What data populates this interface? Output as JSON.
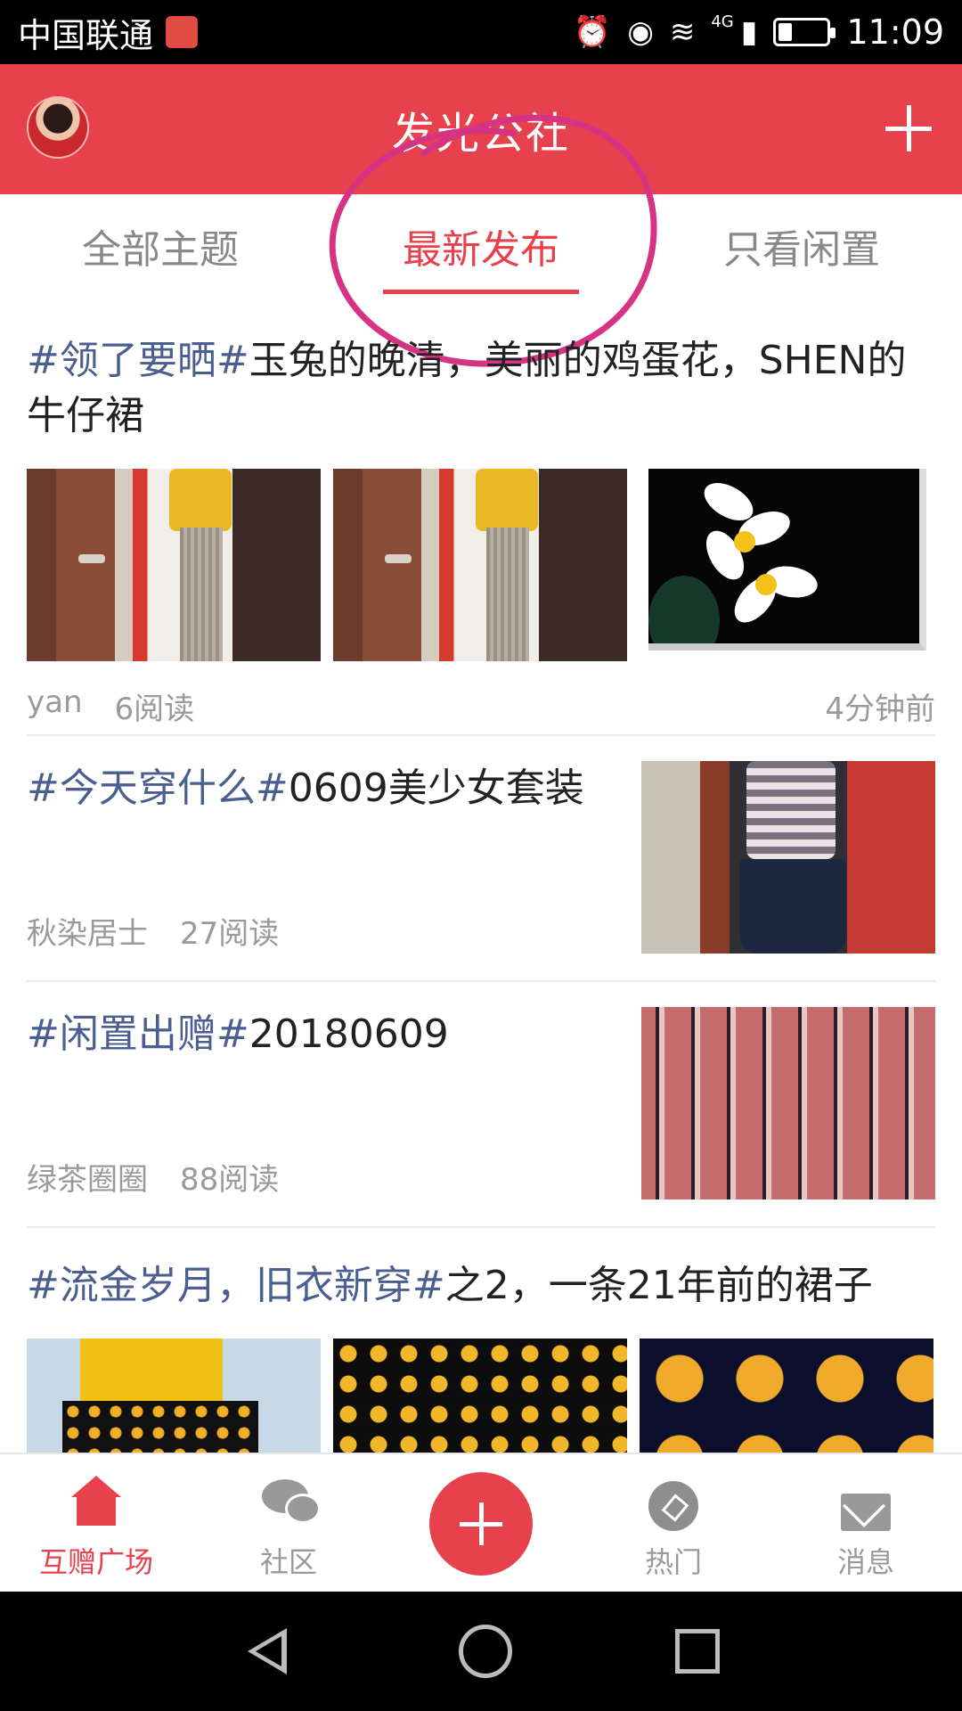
{
  "status_bar": {
    "carrier": "中国联通",
    "network": "4G",
    "time": "11:09",
    "battery_level": 0.25
  },
  "header": {
    "title": "发光公社"
  },
  "tabs": [
    {
      "label": "全部主题",
      "active": false
    },
    {
      "label": "最新发布",
      "active": true
    },
    {
      "label": "只看闲置",
      "active": false
    }
  ],
  "posts": [
    {
      "topic": "#领了要晒#",
      "title": "玉兔的晚清，美丽的鸡蛋花，SHEN的牛仔裙",
      "author": "yan",
      "views": "6阅读",
      "time": "4分钟前"
    },
    {
      "topic": "#今天穿什么#",
      "title": "0609美少女套装",
      "author": "秋染居士",
      "views": "27阅读"
    },
    {
      "topic": "#闲置出赠#",
      "title": "20180609",
      "author": "绿茶圈圈",
      "views": "88阅读"
    },
    {
      "topic": "#流金岁月，旧衣新穿#",
      "title": "之2，一条21年前的裙子"
    }
  ],
  "bottom_nav": [
    {
      "label": "互赠广场",
      "active": true
    },
    {
      "label": "社区",
      "active": false
    },
    {
      "label": "热门",
      "active": false
    },
    {
      "label": "消息",
      "active": false
    }
  ],
  "colors": {
    "brand": "#e8414e",
    "topic": "#4a5f8f",
    "annotation": "#d63384"
  },
  "icons": [
    "avatar",
    "add-icon",
    "home-icon",
    "chat-icon",
    "compass-icon",
    "mail-icon",
    "publish-fab",
    "back-nav-icon",
    "home-nav-icon",
    "recent-apps-icon"
  ]
}
